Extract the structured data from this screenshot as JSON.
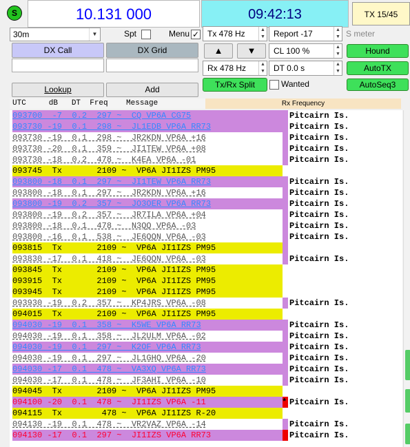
{
  "top": {
    "status_letter": "S",
    "frequency": "10.131 000",
    "clock": "09:42:13",
    "tx_count": "TX 15/45"
  },
  "controls": {
    "band": "30m",
    "spot_label": "Spt",
    "menu_label": "Menu",
    "menu_checked": "✓",
    "tx_freq": "Tx  478  Hz",
    "report": "Report -17",
    "s_meter_label": "S meter",
    "dx_call_label": "DX Call",
    "dx_grid_label": "DX Grid",
    "dx_call_value": "",
    "dx_grid_value": "",
    "up_arrow": "▲",
    "down_arrow": "▼",
    "cl_value": "CL  100 %",
    "hound_label": "Hound",
    "rx_freq": "Rx  478  Hz",
    "dt_value": "DT 0.0 s",
    "autotx_label": "AutoTX",
    "lookup_label": "Lookup",
    "add_label": "Add",
    "txrx_split_label": "Tx/Rx Split",
    "wanted_label": "Wanted",
    "autoseq_label": "AutoSeq3"
  },
  "list_header": {
    "columns": "UTC     dB   DT  Freq    Message",
    "rx_frequency": "Rx Frequency"
  },
  "colors": {
    "cq_bg": "#cc88dd",
    "cq_text": "#3388ff",
    "tx_bg": "#ecec00",
    "me_text": "#ff0033",
    "green": "#3ee05a"
  },
  "rows": [
    {
      "text": "093700  -7  0.2  297 ~  CQ VP6A CG75",
      "type": "cq",
      "mark": "purple",
      "pit": "Pitcairn Is."
    },
    {
      "text": "093730 -19  0.1  298 ~  JL1EDB VP6A RR73",
      "type": "call",
      "mark": "purple",
      "pit": "Pitcairn Is."
    },
    {
      "text": "093730 -19  0.1  298 ~  JR2KDN VP6A +16",
      "type": "norm",
      "mark": "purple",
      "pit": "Pitcairn Is."
    },
    {
      "text": "093730 -20  0.1  359 ~  JI1TEW VP6A +08",
      "type": "norm",
      "mark": "purple",
      "pit": "Pitcairn Is."
    },
    {
      "text": "093730 -18  0.2  478 ~  K4EA VP6A -01",
      "type": "norm",
      "mark": "purple",
      "pit": "Pitcairn Is."
    },
    {
      "text": "093745  Tx       2109 ~  VP6A JI1IZS PM95",
      "type": "tx",
      "mark": "none",
      "pit": ""
    },
    {
      "text": "093800 -18  0.1  297 ~  JI1TEW VP6A RR73",
      "type": "call",
      "mark": "purple",
      "pit": "Pitcairn Is."
    },
    {
      "text": "093800 -18  0.1  297 ~  JR2KDN VP6A +16",
      "type": "norm",
      "mark": "purple",
      "pit": "Pitcairn Is."
    },
    {
      "text": "093800 -19  0.2  357 ~  JO3OER VP6A RR73",
      "type": "call",
      "mark": "purple",
      "pit": "Pitcairn Is."
    },
    {
      "text": "093800 -19  0.2  357 ~  JR7ILA VP6A +04",
      "type": "norm",
      "mark": "purple",
      "pit": "Pitcairn Is."
    },
    {
      "text": "093800 -18  0.1  478 ~  N3QQ VP6A -03",
      "type": "norm",
      "mark": "purple",
      "pit": "Pitcairn Is."
    },
    {
      "text": "093800 -16  0.1  538 ~  JE6QQN VP6A -03",
      "type": "norm",
      "mark": "purple",
      "pit": "Pitcairn Is."
    },
    {
      "text": "093815  Tx       2109 ~  VP6A JI1IZS PM95",
      "type": "tx",
      "mark": "purple",
      "pit": ""
    },
    {
      "text": "093830 -17  0.1  418 ~  JE6QQN VP6A -03",
      "type": "norm",
      "mark": "purple",
      "pit": "Pitcairn Is."
    },
    {
      "text": "093845  Tx       2109 ~  VP6A JI1IZS PM95",
      "type": "tx",
      "mark": "none",
      "pit": ""
    },
    {
      "text": "093915  Tx       2109 ~  VP6A JI1IZS PM95",
      "type": "tx",
      "mark": "none",
      "pit": ""
    },
    {
      "text": "093945  Tx       2109 ~  VP6A JI1IZS PM95",
      "type": "tx",
      "mark": "none",
      "pit": ""
    },
    {
      "text": "093930 -19  0.2  357 ~  KP4JRS VP6A -08",
      "type": "norm",
      "mark": "purple",
      "pit": "Pitcairn Is."
    },
    {
      "text": "094015  Tx       2109 ~  VP6A JI1IZS PM95",
      "type": "tx",
      "mark": "none",
      "pit": ""
    },
    {
      "text": "094030 -19  0.1  358 ~  K5WE VP6A RR73",
      "type": "call",
      "mark": "purple",
      "pit": "Pitcairn Is."
    },
    {
      "text": "094030 -19  0.1  358 ~  JL2ULM VP6A -02",
      "type": "norm",
      "mark": "purple",
      "pit": "Pitcairn Is."
    },
    {
      "text": "094030 -19  0.1  297 ~  K2OF VP6A RR73",
      "type": "call",
      "mark": "purple",
      "pit": "Pitcairn Is."
    },
    {
      "text": "094030 -19  0.1  297 ~  JL1GHQ VP6A -20",
      "type": "norm",
      "mark": "purple",
      "pit": "Pitcairn Is."
    },
    {
      "text": "094030 -17  0.1  478 ~  VA3XQ VP6A RR73",
      "type": "call",
      "mark": "purple",
      "pit": "Pitcairn Is."
    },
    {
      "text": "094030 -17  0.1  478 ~  JF3AHI VP6A -10",
      "type": "norm",
      "mark": "purple",
      "pit": "Pitcairn Is."
    },
    {
      "text": "094045  Tx       2109 ~  VP6A JI1IZS PM95",
      "type": "tx",
      "mark": "none",
      "pit": ""
    },
    {
      "text": "094100 -20  0.1  478 ~  JI1IZS VP6A -11",
      "type": "me",
      "mark": "red-star",
      "pit": "Pitcairn Is."
    },
    {
      "text": "094115  Tx        478 ~  VP6A JI1IZS R-20",
      "type": "tx",
      "mark": "none",
      "pit": ""
    },
    {
      "text": "094130 -19  0.1  478 ~  VR2VAZ VP6A -14",
      "type": "norm",
      "mark": "purple",
      "pit": "Pitcairn Is."
    },
    {
      "text": "094130 -17  0.1  297 ~  JI1IZS VP6A RR73",
      "type": "rr",
      "mark": "red",
      "pit": "Pitcairn Is."
    }
  ]
}
